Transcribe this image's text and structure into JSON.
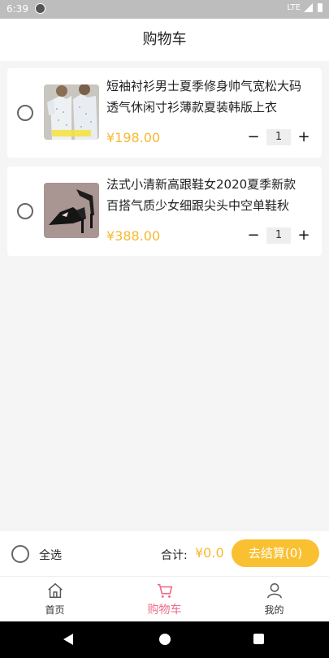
{
  "status": {
    "time": "6:39",
    "network": "LTE"
  },
  "header": {
    "title": "购物车"
  },
  "cart": {
    "items": [
      {
        "title": "短袖衬衫男士夏季修身帅气宽松大码透气休闲寸衫薄款夏装韩版上衣",
        "price": "¥198.00",
        "quantity": "1",
        "image": "shirt-photo"
      },
      {
        "title": "法式小清新高跟鞋女2020夏季新款百搭气质少女细跟尖头中空单鞋秋",
        "price": "¥388.00",
        "quantity": "1",
        "image": "heels-photo"
      }
    ],
    "minus_label": "−",
    "plus_label": "+"
  },
  "summary": {
    "select_all_label": "全选",
    "total_label": "合计:",
    "total_amount": "¥0.0",
    "checkout_label": "去结算(0)"
  },
  "nav": {
    "items": [
      {
        "label": "首页",
        "icon": "home-icon"
      },
      {
        "label": "购物车",
        "icon": "cart-icon"
      },
      {
        "label": "我的",
        "icon": "user-icon"
      }
    ]
  },
  "colors": {
    "accent": "#f9c031",
    "price": "#f7b830",
    "active_nav": "#f06a8a"
  }
}
